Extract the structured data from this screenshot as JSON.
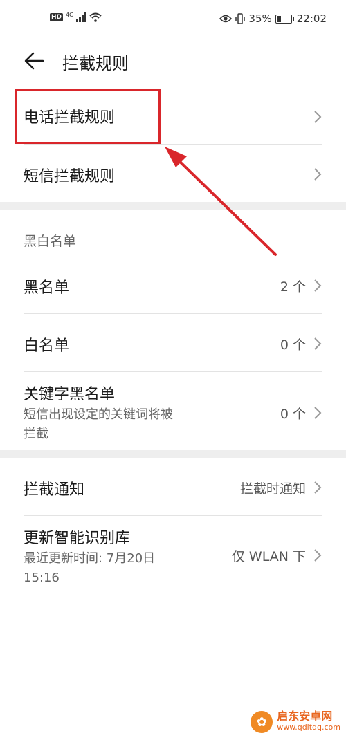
{
  "status_bar": {
    "hd": "HD",
    "network": "4G",
    "battery_percent": "35%",
    "battery_level": 0.35,
    "time": "22:02",
    "icons": [
      "eye-icon",
      "vibrate-icon",
      "wifi-icon",
      "signal-icon",
      "battery-icon"
    ]
  },
  "header": {
    "title": "拦截规则",
    "back_icon": "back-arrow-icon"
  },
  "rules": {
    "call_rules": "电话拦截规则",
    "sms_rules": "短信拦截规则"
  },
  "lists": {
    "section_label": "黑白名单",
    "blacklist": {
      "label": "黑名单",
      "value": "2 个"
    },
    "whitelist": {
      "label": "白名单",
      "value": "0 个"
    },
    "keyword_blacklist": {
      "label": "关键字黑名单",
      "sub_line1": "短信出现设定的关键词将被",
      "sub_line2": "拦截",
      "value": "0 个"
    }
  },
  "settings": {
    "notify": {
      "label": "拦截通知",
      "value": "拦截时通知"
    },
    "update_library": {
      "label": "更新智能识别库",
      "sub_line1": "最近更新时间: 7月20日",
      "sub_line2": "15:16",
      "value": "仅 WLAN 下"
    }
  },
  "annotation": {
    "color": "#d9262b"
  },
  "watermark": {
    "name": "启东安卓网",
    "url": "www.qdltdq.com"
  }
}
